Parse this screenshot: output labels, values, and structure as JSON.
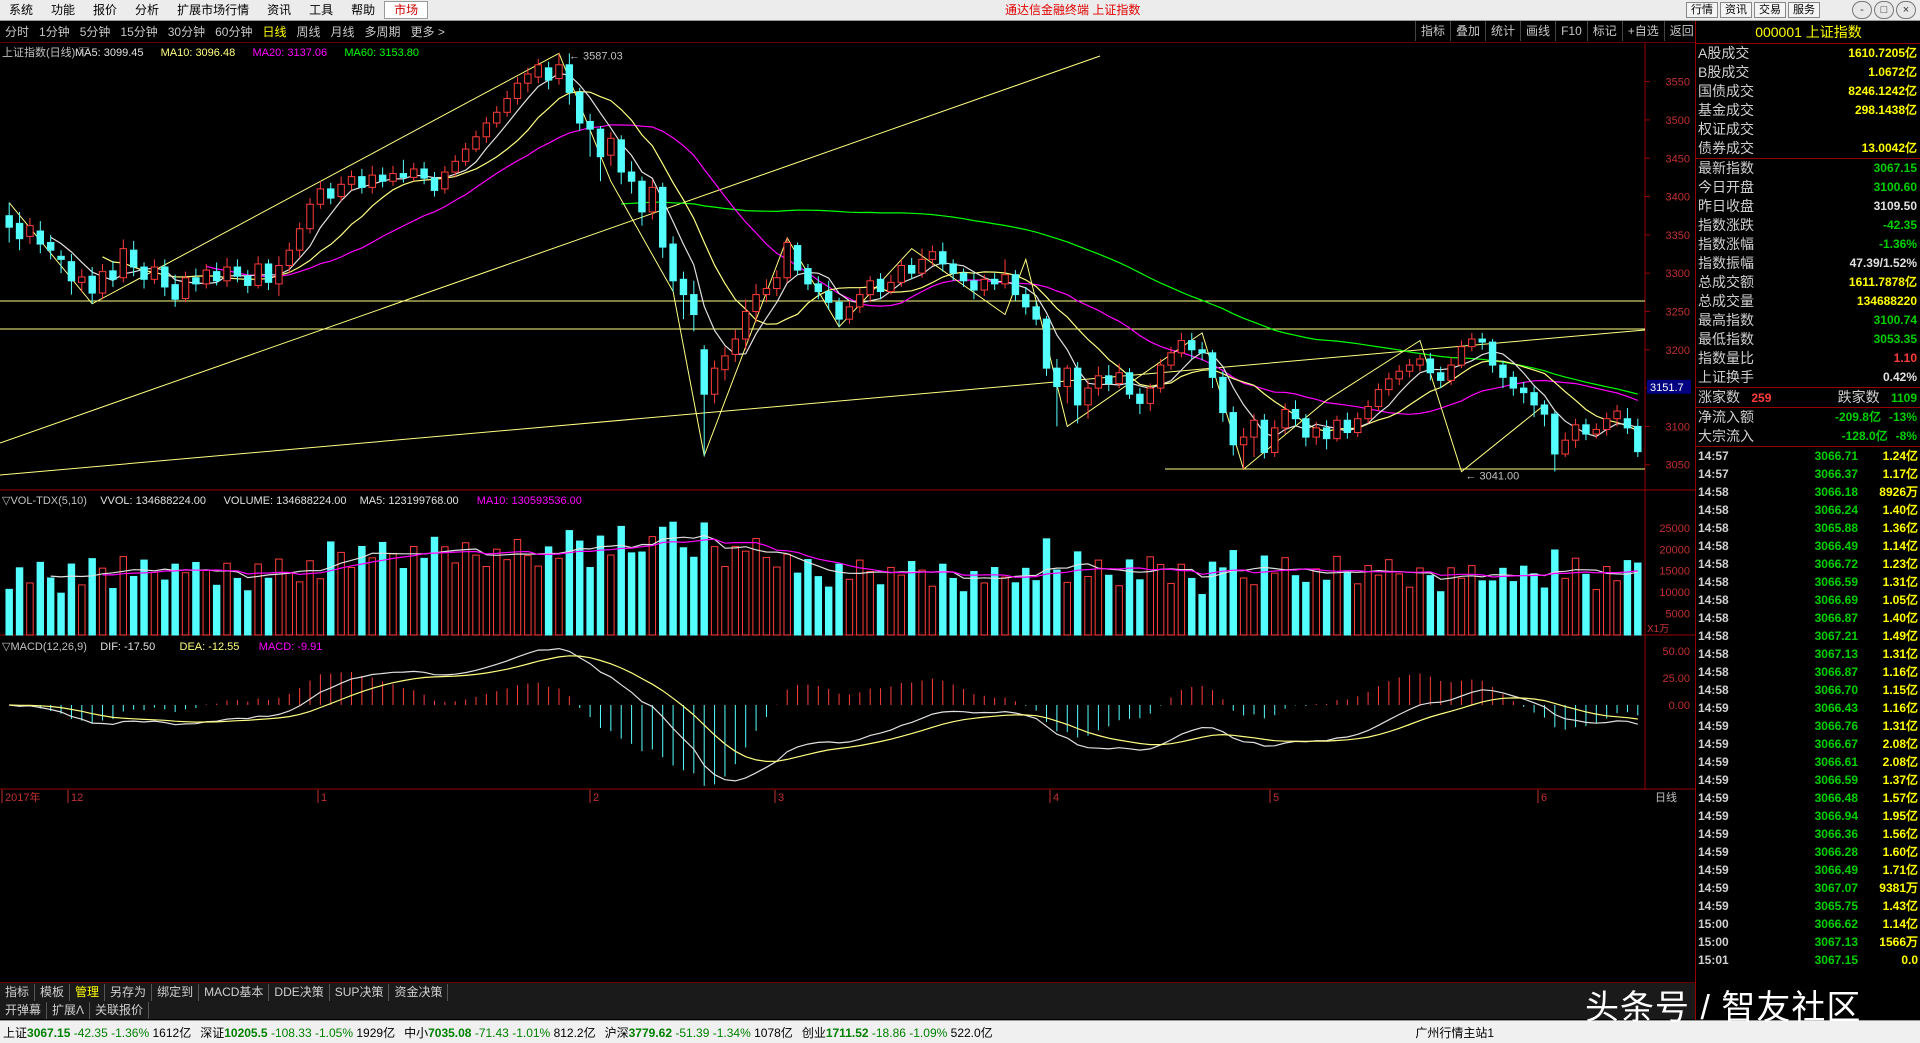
{
  "menubar": {
    "items": [
      "系统",
      "功能",
      "报价",
      "分析",
      "扩展市场行情",
      "资讯",
      "工具",
      "帮助",
      "市场"
    ],
    "selected": "市场",
    "app_title": "通达信金融终端 上证指数",
    "right_buttons": [
      "行情",
      "资讯",
      "交易",
      "服务"
    ],
    "window_buttons": [
      "-",
      "□",
      "×"
    ]
  },
  "periodbar": {
    "items": [
      "分时",
      "1分钟",
      "5分钟",
      "15分钟",
      "30分钟",
      "60分钟",
      "日线",
      "周线",
      "月线",
      "多周期",
      "更多 >"
    ],
    "selected": "日线",
    "tools": [
      "指标",
      "叠加",
      "统计",
      "画线",
      "F10",
      "标记",
      "+自选",
      "返回"
    ]
  },
  "colors": {
    "up": "#ff3c3c",
    "down": "#00d000",
    "bear_fill": "#54ffff",
    "ma5": "#e0e0e0",
    "ma10": "#ffff80",
    "ma20": "#ff00ff",
    "ma60": "#00ff00",
    "vol_ma10": "#ff00ff"
  },
  "main_chart": {
    "header": "上证指数(日线) ▽",
    "ma5": "MA5: 3099.45",
    "ma10": "MA10: 3096.48",
    "ma20": "MA20: 3137.06",
    "ma60": "MA60: 3153.80",
    "high_label": "3587.03",
    "low_label": "3041.00",
    "price_flag": "3151.7",
    "yticks": [
      "3550",
      "3500",
      "3450",
      "3400",
      "3350",
      "3300",
      "3250",
      "3200",
      "3150",
      "3100",
      "3050"
    ]
  },
  "volume_chart": {
    "header": "▽VOL-TDX(5,10)",
    "vvol": "VVOL: 134688224.00",
    "volume": "VOLUME: 134688224.00",
    "ma5": "MA5: 123199768.00",
    "ma10": "MA10: 130593536.00",
    "yticks": [
      "25000",
      "20000",
      "15000",
      "10000",
      "5000"
    ],
    "unit": "X1万"
  },
  "macd_chart": {
    "header": "▽MACD(12,26,9)",
    "dif": "DIF: -17.50",
    "dea": "DEA: -12.55",
    "macd": "MACD: -9.91",
    "yticks": [
      "50.00",
      "25.00",
      "0.00"
    ]
  },
  "date_axis": {
    "labels": [
      "2017年",
      "12",
      "1",
      "2",
      "3",
      "4",
      "5",
      "6"
    ],
    "period_label": "日线"
  },
  "chart_data": {
    "type": "candlestick",
    "ylim": [
      3030,
      3590
    ],
    "candles": [
      [
        3375,
        3360,
        3392,
        3340
      ],
      [
        3365,
        3345,
        3380,
        3330
      ],
      [
        3348,
        3362,
        3372,
        3338
      ],
      [
        3355,
        3338,
        3368,
        3326
      ],
      [
        3340,
        3330,
        3350,
        3318
      ],
      [
        3322,
        3318,
        3330,
        3300
      ],
      [
        3315,
        3290,
        3325,
        3272
      ],
      [
        3288,
        3295,
        3305,
        3275
      ],
      [
        3296,
        3274,
        3308,
        3260
      ],
      [
        3274,
        3302,
        3312,
        3266
      ],
      [
        3303,
        3292,
        3316,
        3282
      ],
      [
        3294,
        3332,
        3344,
        3288
      ],
      [
        3330,
        3308,
        3342,
        3296
      ],
      [
        3308,
        3292,
        3314,
        3280
      ],
      [
        3292,
        3308,
        3318,
        3286
      ],
      [
        3308,
        3282,
        3318,
        3270
      ],
      [
        3285,
        3266,
        3298,
        3256
      ],
      [
        3267,
        3294,
        3302,
        3262
      ],
      [
        3294,
        3286,
        3306,
        3276
      ],
      [
        3286,
        3304,
        3312,
        3280
      ],
      [
        3302,
        3290,
        3314,
        3284
      ],
      [
        3290,
        3308,
        3320,
        3282
      ],
      [
        3308,
        3296,
        3318,
        3288
      ],
      [
        3296,
        3284,
        3304,
        3274
      ],
      [
        3284,
        3312,
        3322,
        3280
      ],
      [
        3312,
        3288,
        3318,
        3278
      ],
      [
        3286,
        3310,
        3322,
        3270
      ],
      [
        3310,
        3330,
        3340,
        3300
      ],
      [
        3330,
        3358,
        3366,
        3320
      ],
      [
        3358,
        3390,
        3398,
        3352
      ],
      [
        3390,
        3410,
        3420,
        3384
      ],
      [
        3410,
        3398,
        3418,
        3390
      ],
      [
        3400,
        3416,
        3426,
        3394
      ],
      [
        3416,
        3426,
        3434,
        3408
      ],
      [
        3426,
        3412,
        3436,
        3404
      ],
      [
        3412,
        3428,
        3440,
        3404
      ],
      [
        3428,
        3420,
        3438,
        3412
      ],
      [
        3420,
        3430,
        3440,
        3414
      ],
      [
        3430,
        3425,
        3448,
        3418
      ],
      [
        3425,
        3436,
        3444,
        3420
      ],
      [
        3436,
        3424,
        3445,
        3416
      ],
      [
        3424,
        3408,
        3432,
        3400
      ],
      [
        3410,
        3432,
        3440,
        3404
      ],
      [
        3432,
        3446,
        3454,
        3426
      ],
      [
        3446,
        3462,
        3470,
        3440
      ],
      [
        3462,
        3478,
        3486,
        3458
      ],
      [
        3478,
        3496,
        3504,
        3470
      ],
      [
        3496,
        3510,
        3518,
        3490
      ],
      [
        3510,
        3528,
        3538,
        3504
      ],
      [
        3528,
        3548,
        3556,
        3520
      ],
      [
        3548,
        3560,
        3568,
        3536
      ],
      [
        3556,
        3572,
        3580,
        3548
      ],
      [
        3568,
        3552,
        3576,
        3540
      ],
      [
        3554,
        3572,
        3587,
        3546
      ],
      [
        3572,
        3536,
        3587,
        3520
      ],
      [
        3536,
        3496,
        3542,
        3486
      ],
      [
        3498,
        3488,
        3508,
        3452
      ],
      [
        3488,
        3452,
        3492,
        3420
      ],
      [
        3454,
        3476,
        3484,
        3440
      ],
      [
        3474,
        3432,
        3480,
        3416
      ],
      [
        3432,
        3420,
        3446,
        3404
      ],
      [
        3420,
        3380,
        3426,
        3362
      ],
      [
        3380,
        3412,
        3422,
        3370
      ],
      [
        3412,
        3334,
        3418,
        3320
      ],
      [
        3338,
        3290,
        3348,
        3276
      ],
      [
        3292,
        3272,
        3302,
        3240
      ],
      [
        3272,
        3246,
        3290,
        3224
      ],
      [
        3200,
        3142,
        3206,
        3062
      ],
      [
        3142,
        3176,
        3186,
        3130
      ],
      [
        3174,
        3192,
        3204,
        3160
      ],
      [
        3194,
        3214,
        3226,
        3184
      ],
      [
        3214,
        3250,
        3266,
        3200
      ],
      [
        3250,
        3272,
        3286,
        3236
      ],
      [
        3272,
        3280,
        3292,
        3262
      ],
      [
        3280,
        3294,
        3304,
        3270
      ],
      [
        3294,
        3340,
        3346,
        3288
      ],
      [
        3336,
        3304,
        3340,
        3298
      ],
      [
        3306,
        3286,
        3312,
        3278
      ],
      [
        3286,
        3276,
        3296,
        3266
      ],
      [
        3276,
        3262,
        3290,
        3252
      ],
      [
        3262,
        3240,
        3268,
        3230
      ],
      [
        3240,
        3256,
        3264,
        3234
      ],
      [
        3256,
        3272,
        3280,
        3248
      ],
      [
        3272,
        3290,
        3296,
        3262
      ],
      [
        3292,
        3276,
        3300,
        3266
      ],
      [
        3276,
        3288,
        3298,
        3272
      ],
      [
        3288,
        3310,
        3318,
        3282
      ],
      [
        3310,
        3300,
        3320,
        3292
      ],
      [
        3300,
        3318,
        3332,
        3294
      ],
      [
        3318,
        3328,
        3336,
        3310
      ],
      [
        3328,
        3312,
        3340,
        3302
      ],
      [
        3312,
        3300,
        3318,
        3290
      ],
      [
        3300,
        3290,
        3306,
        3282
      ],
      [
        3290,
        3278,
        3300,
        3266
      ],
      [
        3278,
        3292,
        3298,
        3270
      ],
      [
        3292,
        3286,
        3300,
        3278
      ],
      [
        3286,
        3298,
        3318,
        3280
      ],
      [
        3298,
        3272,
        3304,
        3264
      ],
      [
        3272,
        3256,
        3282,
        3246
      ],
      [
        3256,
        3240,
        3264,
        3232
      ],
      [
        3240,
        3176,
        3244,
        3166
      ],
      [
        3176,
        3152,
        3188,
        3100
      ],
      [
        3152,
        3176,
        3180,
        3130
      ],
      [
        3176,
        3128,
        3184,
        3104
      ],
      [
        3128,
        3150,
        3160,
        3110
      ],
      [
        3150,
        3166,
        3178,
        3140
      ],
      [
        3166,
        3156,
        3180,
        3146
      ],
      [
        3156,
        3170,
        3182,
        3150
      ],
      [
        3170,
        3142,
        3176,
        3136
      ],
      [
        3142,
        3130,
        3150,
        3116
      ],
      [
        3130,
        3150,
        3156,
        3120
      ],
      [
        3150,
        3180,
        3188,
        3144
      ],
      [
        3180,
        3196,
        3204,
        3174
      ],
      [
        3196,
        3212,
        3222,
        3190
      ],
      [
        3212,
        3200,
        3222,
        3188
      ],
      [
        3200,
        3196,
        3210,
        3186
      ],
      [
        3196,
        3164,
        3200,
        3150
      ],
      [
        3164,
        3118,
        3172,
        3106
      ],
      [
        3118,
        3076,
        3126,
        3062
      ],
      [
        3076,
        3086,
        3098,
        3044
      ],
      [
        3086,
        3108,
        3116,
        3060
      ],
      [
        3108,
        3066,
        3116,
        3058
      ],
      [
        3066,
        3098,
        3108,
        3060
      ],
      [
        3098,
        3122,
        3130,
        3090
      ],
      [
        3122,
        3110,
        3134,
        3100
      ],
      [
        3110,
        3086,
        3116,
        3074
      ],
      [
        3086,
        3098,
        3106,
        3076
      ],
      [
        3098,
        3084,
        3108,
        3070
      ],
      [
        3084,
        3108,
        3114,
        3080
      ],
      [
        3108,
        3092,
        3118,
        3084
      ],
      [
        3092,
        3110,
        3118,
        3086
      ],
      [
        3110,
        3126,
        3134,
        3104
      ],
      [
        3126,
        3148,
        3156,
        3120
      ],
      [
        3148,
        3162,
        3170,
        3140
      ],
      [
        3162,
        3172,
        3180,
        3154
      ],
      [
        3172,
        3180,
        3188,
        3164
      ],
      [
        3180,
        3188,
        3194,
        3172
      ],
      [
        3188,
        3170,
        3196,
        3160
      ],
      [
        3170,
        3160,
        3178,
        3150
      ],
      [
        3160,
        3180,
        3190,
        3154
      ],
      [
        3180,
        3204,
        3212,
        3176
      ],
      [
        3204,
        3214,
        3222,
        3198
      ],
      [
        3214,
        3210,
        3222,
        3200
      ],
      [
        3210,
        3180,
        3214,
        3170
      ],
      [
        3180,
        3164,
        3186,
        3150
      ],
      [
        3164,
        3150,
        3172,
        3140
      ],
      [
        3150,
        3144,
        3158,
        3130
      ],
      [
        3144,
        3128,
        3152,
        3112
      ],
      [
        3128,
        3116,
        3134,
        3100
      ],
      [
        3116,
        3064,
        3120,
        3041
      ],
      [
        3064,
        3082,
        3092,
        3060
      ],
      [
        3082,
        3102,
        3110,
        3072
      ],
      [
        3102,
        3090,
        3110,
        3082
      ],
      [
        3090,
        3096,
        3104,
        3084
      ],
      [
        3096,
        3110,
        3118,
        3088
      ],
      [
        3110,
        3120,
        3128,
        3100
      ],
      [
        3110,
        3098,
        3124,
        3090
      ],
      [
        3100,
        3067,
        3110,
        3060
      ]
    ]
  },
  "info_panel": {
    "title": "000001 上证指数",
    "rows1": [
      {
        "k": "A股成交",
        "v": "1610.7205亿",
        "c": "ye"
      },
      {
        "k": "B股成交",
        "v": "1.0672亿",
        "c": "ye"
      },
      {
        "k": "国债成交",
        "v": "8246.1242亿",
        "c": "ye"
      },
      {
        "k": "基金成交",
        "v": "298.1438亿",
        "c": "ye"
      },
      {
        "k": "权证成交",
        "v": "",
        "c": "ye"
      },
      {
        "k": "债券成交",
        "v": "13.0042亿",
        "c": "ye"
      }
    ],
    "rows2": [
      {
        "k": "最新指数",
        "v": "3067.15",
        "c": "dn"
      },
      {
        "k": "今日开盘",
        "v": "3100.60",
        "c": "dn"
      },
      {
        "k": "昨日收盘",
        "v": "3109.50",
        "c": "w"
      },
      {
        "k": "指数涨跌",
        "v": "-42.35",
        "c": "dn"
      },
      {
        "k": "指数涨幅",
        "v": "-1.36%",
        "c": "dn"
      },
      {
        "k": "指数振幅",
        "v": "47.39/1.52%",
        "c": "w"
      },
      {
        "k": "总成交额",
        "v": "1611.7878亿",
        "c": "ye"
      },
      {
        "k": "总成交量",
        "v": "134688220",
        "c": "ye"
      },
      {
        "k": "最高指数",
        "v": "3100.74",
        "c": "dn"
      },
      {
        "k": "最低指数",
        "v": "3053.35",
        "c": "dn"
      },
      {
        "k": "指数量比",
        "v": "1.10",
        "c": "up"
      },
      {
        "k": "上证换手",
        "v": "0.42%",
        "c": "w"
      }
    ],
    "rise_label": "涨家数",
    "rise_count": "259",
    "fall_label": "跌家数",
    "fall_count": "1109",
    "rows3": [
      {
        "k": "净流入额",
        "v": "-209.8亿",
        "pct": "-13%"
      },
      {
        "k": "大宗流入",
        "v": "-128.0亿",
        "pct": "-8%"
      }
    ],
    "ticks": [
      [
        "14:57",
        "3066.71",
        "1.24亿"
      ],
      [
        "14:57",
        "3066.37",
        "1.17亿"
      ],
      [
        "14:58",
        "3066.18",
        "8926万"
      ],
      [
        "14:58",
        "3066.24",
        "1.40亿"
      ],
      [
        "14:58",
        "3065.88",
        "1.36亿"
      ],
      [
        "14:58",
        "3066.49",
        "1.14亿"
      ],
      [
        "14:58",
        "3066.72",
        "1.23亿"
      ],
      [
        "14:58",
        "3066.59",
        "1.31亿"
      ],
      [
        "14:58",
        "3066.69",
        "1.05亿"
      ],
      [
        "14:58",
        "3066.87",
        "1.40亿"
      ],
      [
        "14:58",
        "3067.21",
        "1.49亿"
      ],
      [
        "14:58",
        "3067.13",
        "1.31亿"
      ],
      [
        "14:58",
        "3066.87",
        "1.16亿"
      ],
      [
        "14:58",
        "3066.70",
        "1.15亿"
      ],
      [
        "14:59",
        "3066.43",
        "1.16亿"
      ],
      [
        "14:59",
        "3066.76",
        "1.31亿"
      ],
      [
        "14:59",
        "3066.67",
        "2.08亿"
      ],
      [
        "14:59",
        "3066.61",
        "2.08亿"
      ],
      [
        "14:59",
        "3066.59",
        "1.37亿"
      ],
      [
        "14:59",
        "3066.48",
        "1.57亿"
      ],
      [
        "14:59",
        "3066.94",
        "1.95亿"
      ],
      [
        "14:59",
        "3066.36",
        "1.56亿"
      ],
      [
        "14:59",
        "3066.28",
        "1.60亿"
      ],
      [
        "14:59",
        "3066.49",
        "1.71亿"
      ],
      [
        "14:59",
        "3067.07",
        "9381万"
      ],
      [
        "14:59",
        "3065.75",
        "1.43亿"
      ],
      [
        "15:00",
        "3066.62",
        "1.14亿"
      ],
      [
        "15:00",
        "3067.13",
        "1566万"
      ],
      [
        "15:01",
        "3067.15",
        "0.0"
      ]
    ]
  },
  "toolbar2": {
    "items": [
      "指标",
      "模板",
      "管理",
      "另存为",
      "绑定到",
      "MACD基本",
      "DDE决策",
      "SUP决策",
      "资金决策"
    ],
    "selected": "管理"
  },
  "toolbar3": {
    "items": [
      "开弹幕",
      "扩展Λ",
      "关联报价"
    ]
  },
  "statusbar": [
    {
      "name": "上证",
      "val": "3067.15",
      "chg": "-42.35",
      "pct": "-1.36%",
      "amt": "1612亿"
    },
    {
      "name": "深证",
      "val": "10205.5",
      "chg": "-108.33",
      "pct": "-1.05%",
      "amt": "1929亿"
    },
    {
      "name": "中小",
      "val": "7035.08",
      "chg": "-71.43",
      "pct": "-1.01%",
      "amt": "812.2亿"
    },
    {
      "name": "沪深",
      "val": "3779.62",
      "chg": "-51.39",
      "pct": "-1.34%",
      "amt": "1078亿"
    },
    {
      "name": "创业",
      "val": "1711.52",
      "chg": "-18.86",
      "pct": "-1.09%",
      "amt": "522.0亿"
    }
  ],
  "status_right": "广州行情主站1",
  "watermark": "头条号 / 智友社区"
}
